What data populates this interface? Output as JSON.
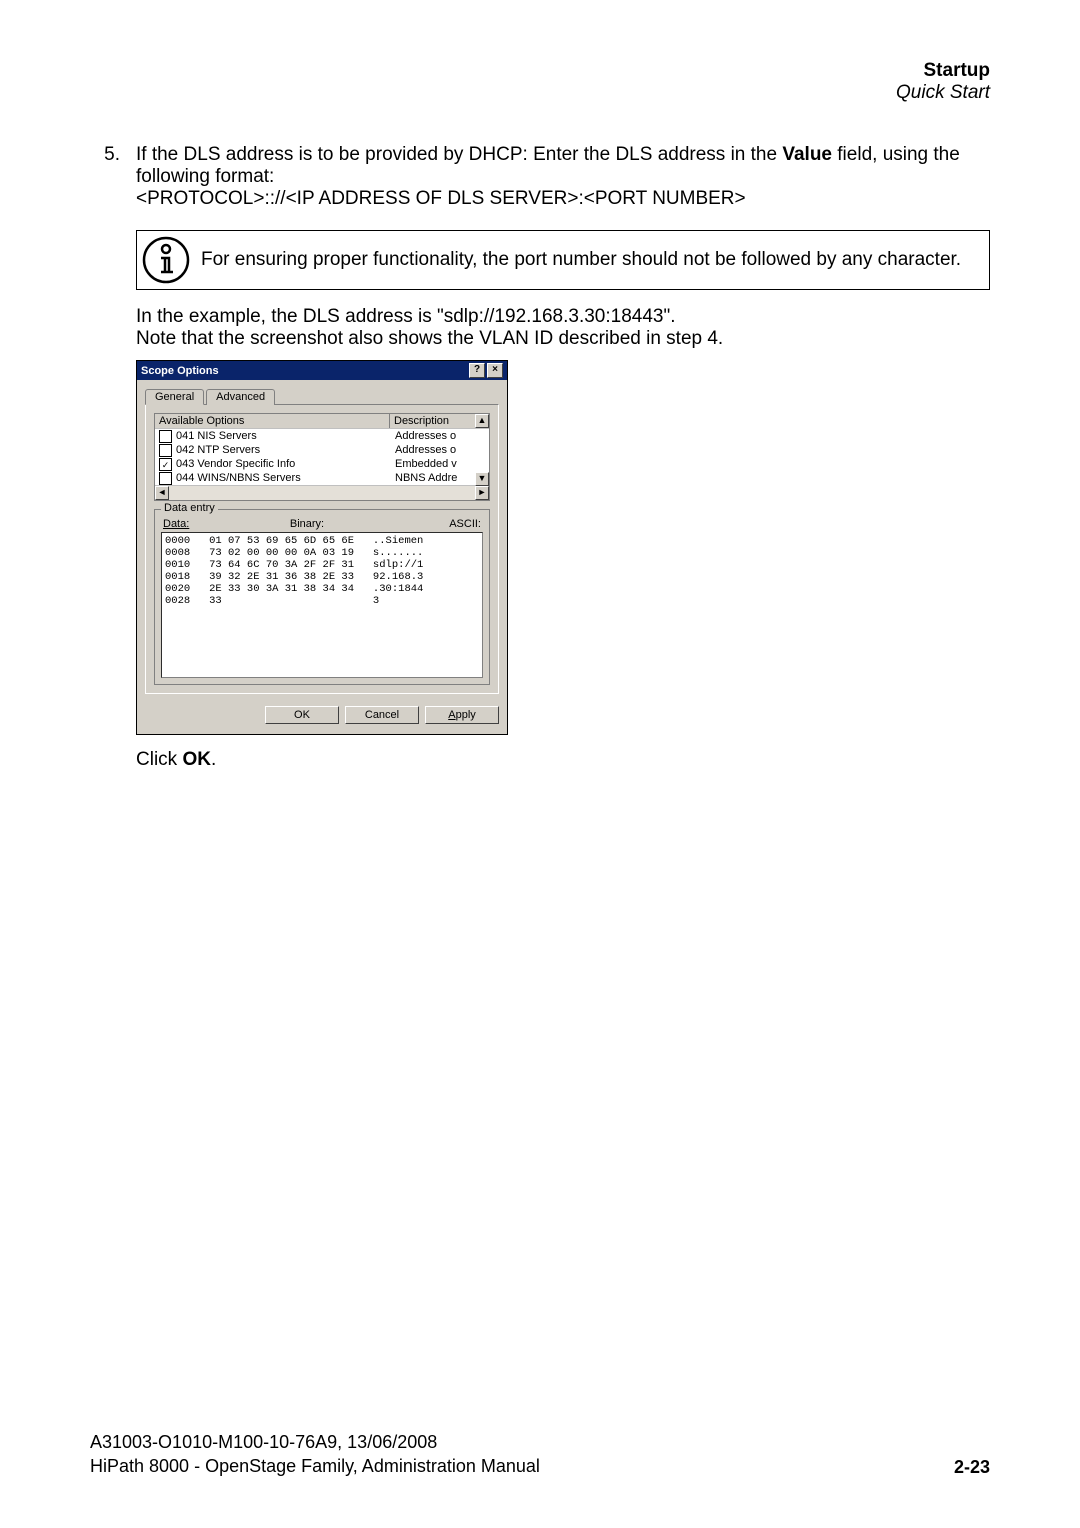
{
  "header": {
    "title": "Startup",
    "subtitle": "Quick Start"
  },
  "step": {
    "number": "5.",
    "line1a": "If the DLS address is to be provided by DHCP: Enter the DLS address in the ",
    "value_word": "Value",
    "line1b": " field, using the following format:",
    "line2": "<PROTOCOL>::/​/<IP ADDRESS OF DLS SERVER>:<PORT NUMBER>"
  },
  "note": {
    "text": "For ensuring proper functionality, the port number should not be followed by any character."
  },
  "example": {
    "line1": "In the example, the DLS address is \"sdlp://192.168.3.30:18443\".",
    "line2": "Note that the screenshot also shows the VLAN ID described in step 4."
  },
  "dialog": {
    "title": "Scope Options",
    "tabs": {
      "general": "General",
      "advanced": "Advanced"
    },
    "list": {
      "col_options": "Available Options",
      "col_desc": "Description",
      "rows": [
        {
          "checked": false,
          "name": "041 NIS Servers",
          "desc": "Addresses o"
        },
        {
          "checked": false,
          "name": "042 NTP Servers",
          "desc": "Addresses o"
        },
        {
          "checked": true,
          "name": "043 Vendor Specific Info",
          "desc": "Embedded v"
        },
        {
          "checked": false,
          "name": "044 WINS/NBNS Servers",
          "desc": "NBNS Addre"
        }
      ]
    },
    "data_entry": {
      "group_label": "Data entry",
      "data_label": "Data:",
      "binary_label": "Binary:",
      "ascii_label": "ASCII:",
      "hex": "0000   01 07 53 69 65 6D 65 6E   ..Siemen\n0008   73 02 00 00 00 0A 03 19   s.......\n0010   73 64 6C 70 3A 2F 2F 31   sdlp://1\n0018   39 32 2E 31 36 38 2E 33   92.168.3\n0020   2E 33 30 3A 31 38 34 34   .30:1844\n0028   33                        3"
    },
    "buttons": {
      "ok": "OK",
      "cancel": "Cancel",
      "apply": "Apply"
    }
  },
  "click_ok": {
    "prefix": "Click ",
    "bold": "OK",
    "suffix": "."
  },
  "footer": {
    "line1": "A31003-O1010-M100-10-76A9, 13/06/2008",
    "line2": "HiPath 8000 - OpenStage Family, Administration Manual",
    "page": "2-23"
  }
}
